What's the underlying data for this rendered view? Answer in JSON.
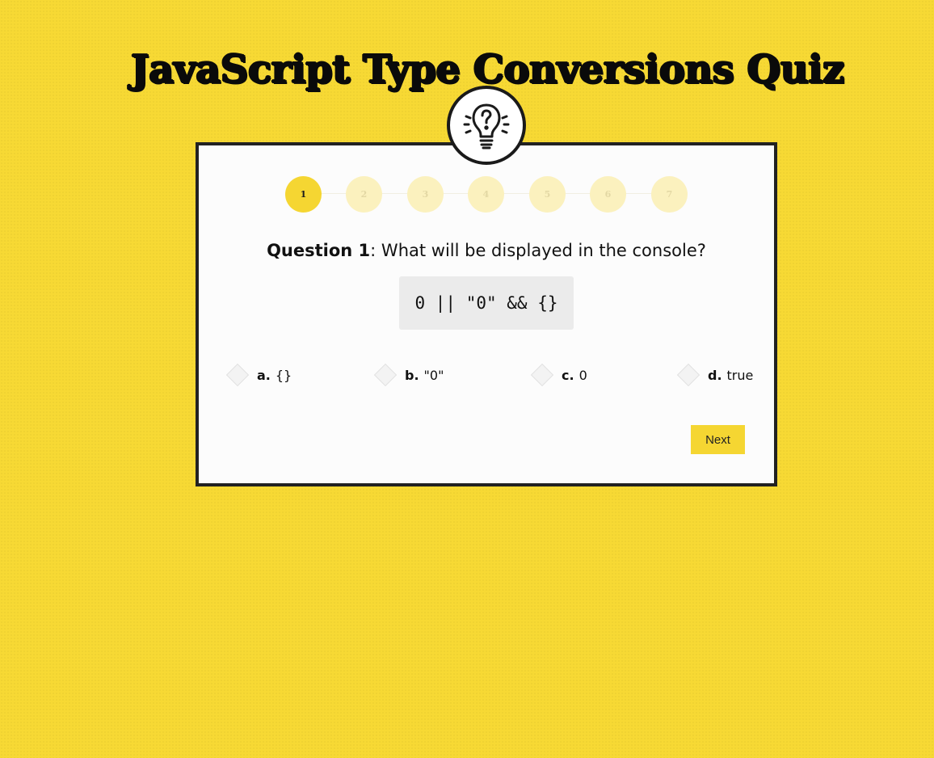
{
  "title": "JavaScript Type Conversions Quiz",
  "icon": "lightbulb-question-icon",
  "steps": [
    {
      "label": "1",
      "active": true
    },
    {
      "label": "2",
      "active": false
    },
    {
      "label": "3",
      "active": false
    },
    {
      "label": "4",
      "active": false
    },
    {
      "label": "5",
      "active": false
    },
    {
      "label": "6",
      "active": false
    },
    {
      "label": "7",
      "active": false
    }
  ],
  "question": {
    "prefix": "Question 1",
    "separator": ":",
    "text": " What will be displayed in the console?",
    "code": "0 || \"0\" && {}"
  },
  "options": [
    {
      "letter": "a.",
      "text": "{}"
    },
    {
      "letter": "b.",
      "text": "\"0\""
    },
    {
      "letter": "c.",
      "text": "0"
    },
    {
      "letter": "d.",
      "text": "true"
    }
  ],
  "next_label": "Next",
  "colors": {
    "background": "#f7d934",
    "accent": "#f5d632",
    "card": "#fcfcfc",
    "border": "#222222"
  }
}
